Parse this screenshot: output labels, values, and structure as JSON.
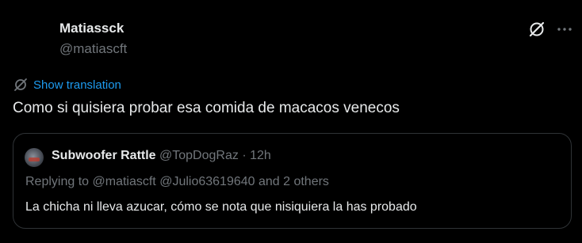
{
  "author": {
    "name": "Matiassck",
    "handle": "@matiascft"
  },
  "actions": {
    "grok_icon": "grok-icon",
    "more_icon": "more-icon"
  },
  "translation": {
    "label": "Show translation"
  },
  "tweet": {
    "text": "Como si quisiera probar esa comida de macacos venecos"
  },
  "quote": {
    "name": "Subwoofer Rattle",
    "handle": "@TopDogRaz",
    "separator": "·",
    "time": "12h",
    "replying": "Replying to @matiascft @Julio63619640 and 2 others",
    "text": "La chicha ni lleva azucar, cómo se nota que nisiquiera la has probado"
  },
  "colors": {
    "background": "#000000",
    "text": "#e7e9ea",
    "muted": "#71767b",
    "accent": "#1d9bf0",
    "border": "#2f3336"
  }
}
